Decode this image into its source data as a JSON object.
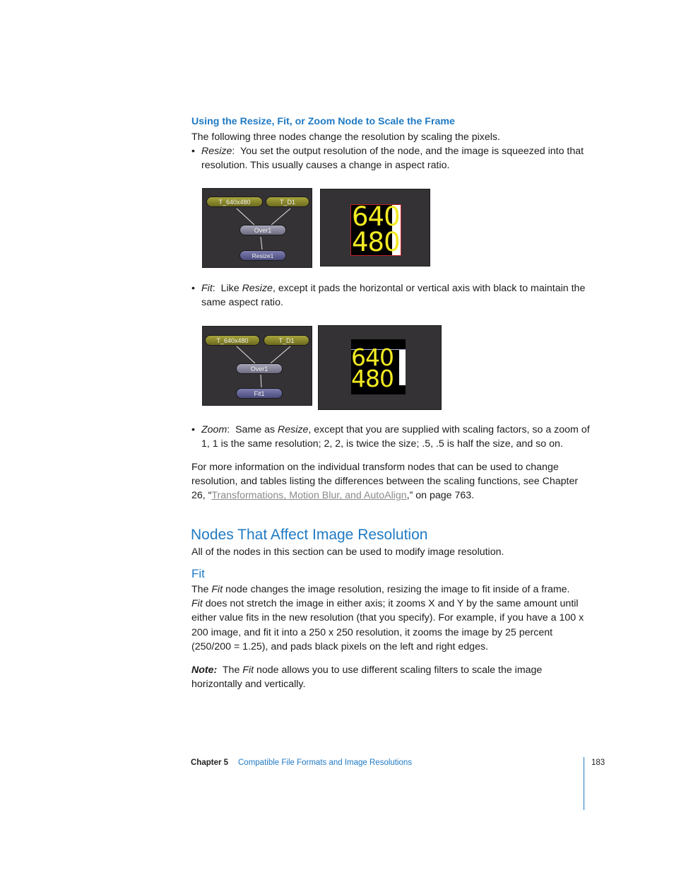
{
  "section_resize": {
    "heading": "Using the Resize, Fit, or Zoom Node to Scale the Frame",
    "intro": "The following three nodes change the resolution by scaling the pixels.",
    "bullets": [
      {
        "term": "Resize",
        "sep": ":  ",
        "text": "You set the output resolution of the node, and the image is squeezed into that resolution. This usually causes a change in aspect ratio."
      },
      {
        "term": "Fit",
        "sep": ":  Like ",
        "term2": "Resize",
        "text": ", except it pads the horizontal or vertical axis with black to maintain the same aspect ratio."
      },
      {
        "term": "Zoom",
        "sep": ":  Same as ",
        "term2": "Resize",
        "text": ", except that you are supplied with scaling factors, so a zoom of 1, 1 is the same resolution; 2, 2, is twice the size; .5, .5 is half the size, and so on."
      }
    ]
  },
  "figures": {
    "resize_tree": {
      "nodes": [
        "T_640x480",
        "T_D1",
        "Over1",
        "Resize1"
      ]
    },
    "fit_tree": {
      "nodes": [
        "T_640x480",
        "T_D1",
        "Over1",
        "Fit1"
      ]
    },
    "viewer": {
      "line1": "640",
      "line2": "480"
    }
  },
  "more_info": {
    "pre": "For more information on the individual transform nodes that can be used to change resolution, and tables listing the differences between the scaling functions, see Chapter 26, “",
    "link": "Transformations, Motion Blur, and AutoAlign",
    "post": ",” on page 763."
  },
  "section_nodes": {
    "heading": "Nodes That Affect Image Resolution",
    "intro": "All of the nodes in this section can be used to modify image resolution."
  },
  "section_fit": {
    "heading": "Fit",
    "p1_pre": "The ",
    "p1_term": "Fit",
    "p1_post": " node changes the image resolution, resizing the image to fit inside of a frame.",
    "p2_term": "Fit",
    "p2_post": " does not stretch the image in either axis; it zooms X and Y by the same amount until either value fits in the new resolution (that you specify). For example, if you have a 100 x 200 image, and fit it into a 250 x 250 resolution, it zooms the image by 25 percent (250/200 = 1.25), and pads black pixels on the left and right edges.",
    "note_label": "Note:",
    "note_pre": "  The ",
    "note_term": "Fit",
    "note_post": " node allows you to use different scaling filters to scale the image horizontally and vertically."
  },
  "footer": {
    "chapter": "Chapter 5",
    "title": "Compatible File Formats and Image Resolutions",
    "page": "183"
  },
  "colors": {
    "accent": "#1f7ac4",
    "link": "#8a8a8a"
  }
}
